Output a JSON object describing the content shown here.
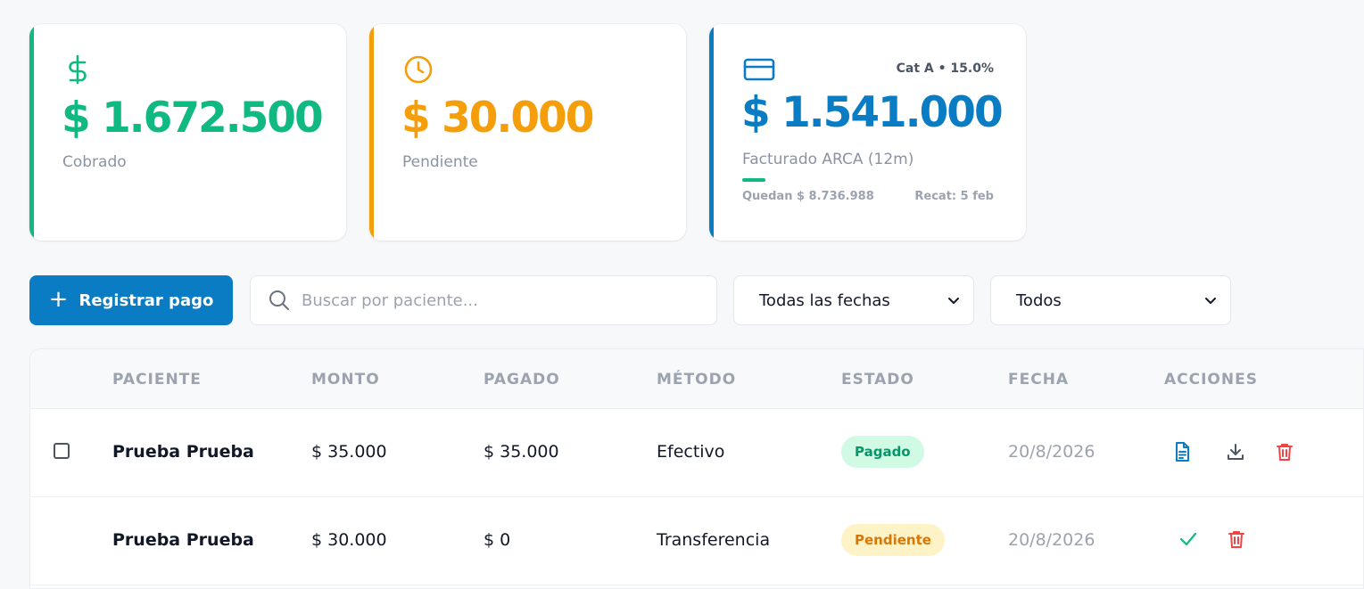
{
  "cards": {
    "cobrado": {
      "amount": "$ 1.672.500",
      "label": "Cobrado",
      "icon": "dollar-icon",
      "color": "#10b981"
    },
    "pendiente": {
      "amount": "$ 30.000",
      "label": "Pendiente",
      "icon": "clock-icon",
      "color": "#f59e0b"
    },
    "facturado": {
      "amount": "$ 1.541.000",
      "label": "Facturado ARCA (12m)",
      "category": "Cat A • 15.0%",
      "remaining": "Quedan $ 8.736.988",
      "recat": "Recat: 5 feb",
      "icon": "credit-card-icon",
      "color": "#0a7cc4",
      "progress": 0.15
    }
  },
  "toolbar": {
    "register_label": "Registrar pago",
    "search_placeholder": "Buscar por paciente...",
    "date_filter": "Todas las fechas",
    "status_filter": "Todos"
  },
  "table": {
    "headers": [
      "PACIENTE",
      "MONTO",
      "PAGADO",
      "MÉTODO",
      "ESTADO",
      "FECHA",
      "ACCIONES"
    ],
    "rows": [
      {
        "patient": "Prueba Prueba",
        "amount": "$ 35.000",
        "paid": "$ 35.000",
        "method": "Efectivo",
        "status": "Pagado",
        "date": "20/8/2026",
        "actions": [
          "invoice-icon",
          "download-icon",
          "trash-icon"
        ]
      },
      {
        "patient": "Prueba Prueba",
        "amount": "$ 30.000",
        "paid": "$ 0",
        "method": "Transferencia",
        "status": "Pendiente",
        "date": "20/8/2026",
        "actions": [
          "check-icon",
          "trash-icon"
        ]
      }
    ]
  }
}
